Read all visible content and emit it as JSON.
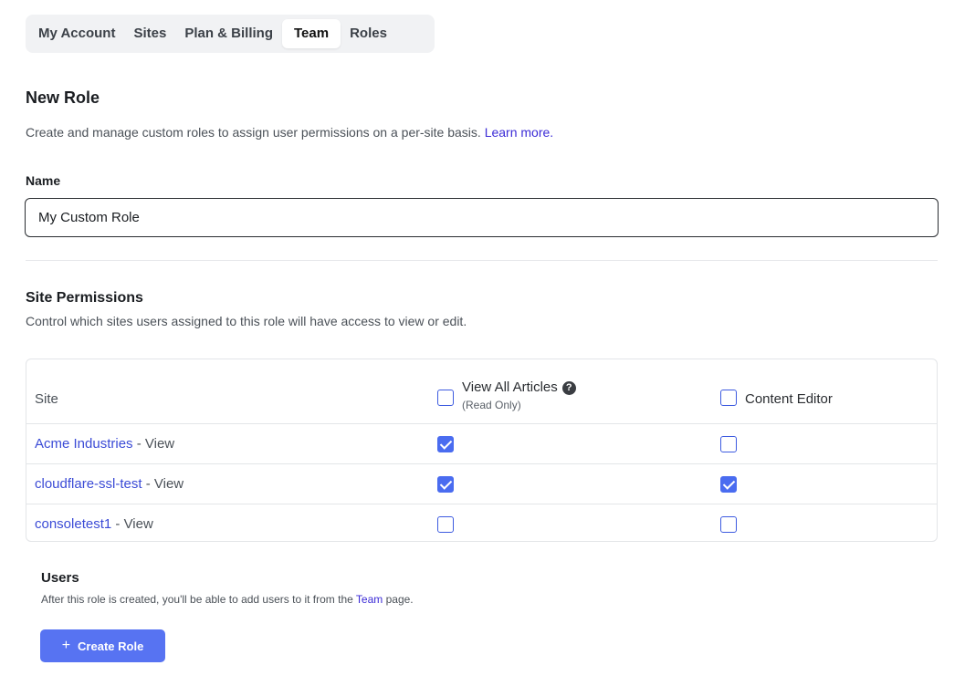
{
  "tabs": [
    {
      "label": "My Account",
      "active": false
    },
    {
      "label": "Sites",
      "active": false
    },
    {
      "label": "Plan & Billing",
      "active": false
    },
    {
      "label": "Team",
      "active": true
    },
    {
      "label": "Roles",
      "active": false
    }
  ],
  "page": {
    "title": "New Role",
    "description": "Create and manage custom roles to assign user permissions on a per-site basis.",
    "learn_more": "Learn more."
  },
  "name_field": {
    "label": "Name",
    "value": "My Custom Role"
  },
  "site_permissions": {
    "title": "Site Permissions",
    "description": "Control which sites users assigned to this role will have access to view or edit.",
    "columns": {
      "site": "Site",
      "view_all": "View All Articles",
      "view_all_sub": "(Read Only)",
      "content_editor": "Content Editor"
    },
    "header_checks": {
      "view_all": false,
      "content_editor": false
    },
    "rows": [
      {
        "site": "Acme Industries",
        "suffix": " - View",
        "view_all": true,
        "content_editor": false
      },
      {
        "site": "cloudflare-ssl-test",
        "suffix": " - View",
        "view_all": true,
        "content_editor": true
      },
      {
        "site": "consoletest1",
        "suffix": " - View",
        "view_all": false,
        "content_editor": false
      }
    ]
  },
  "users": {
    "title": "Users",
    "desc_before": "After this role is created, you'll be able to add users to it from the ",
    "team_link": "Team",
    "desc_after": " page."
  },
  "create_button": {
    "icon": "+",
    "label": "Create Role"
  },
  "colors": {
    "accent": "#5773f2",
    "link": "#3b2bd6"
  }
}
